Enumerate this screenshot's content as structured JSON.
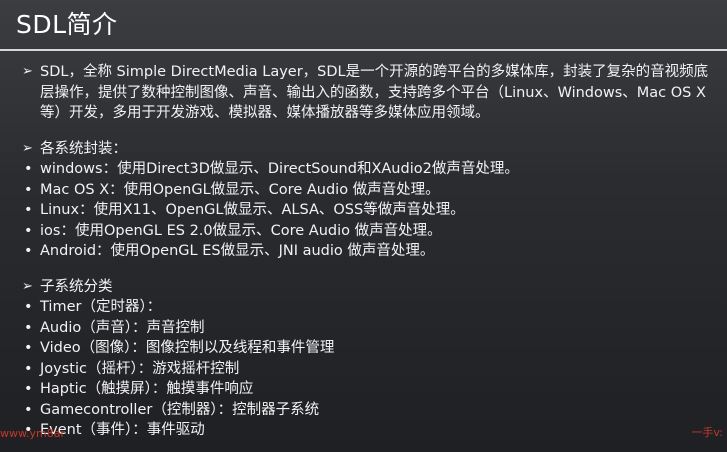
{
  "slide": {
    "title": "SDL简介",
    "intro": "SDL，全称 Simple DirectMedia Layer，SDL是一个开源的跨平台的多媒体库，封装了复杂的音视频底层操作，提供了数种控制图像、声音、输出入的函数，支持跨多个平台（Linux、Windows、Mac OS X等）开发，多用于开发游戏、模拟器、媒体播放器等多媒体应用领域。",
    "platforms_heading": "各系统封装：",
    "platforms": [
      "windows：使用Direct3D做显示、DirectSound和XAudio2做声音处理。",
      "Mac OS X：使用OpenGL做显示、Core Audio 做声音处理。",
      "Linux：使用X11、OpenGL做显示、ALSA、OSS等做声音处理。",
      "ios：使用OpenGL ES 2.0做显示、Core Audio 做声音处理。",
      "Android：使用OpenGL ES做显示、JNI audio 做声音处理。"
    ],
    "subsystems_heading": "子系统分类",
    "subsystems": [
      "Timer（定时器）：",
      "Audio（声音）：声音控制",
      "Video（图像）：图像控制以及线程和事件管理",
      "Joystic（摇杆）：游戏摇杆控制",
      "Haptic（触摸屏）：触摸事件响应",
      "Gamecontroller（控制器）：控制器子系统",
      "Event（事件）：事件驱动"
    ],
    "arrow_glyph": "➢",
    "bullet_glyph": "•"
  },
  "watermark": {
    "left": "www.ym8ar",
    "right": "一手v:"
  },
  "colors": {
    "background_top": "#3b3d41",
    "background_bottom": "#1f2023",
    "text": "#f2f2f2",
    "divider": "#d7d7d7",
    "watermark": "#c0392b"
  }
}
